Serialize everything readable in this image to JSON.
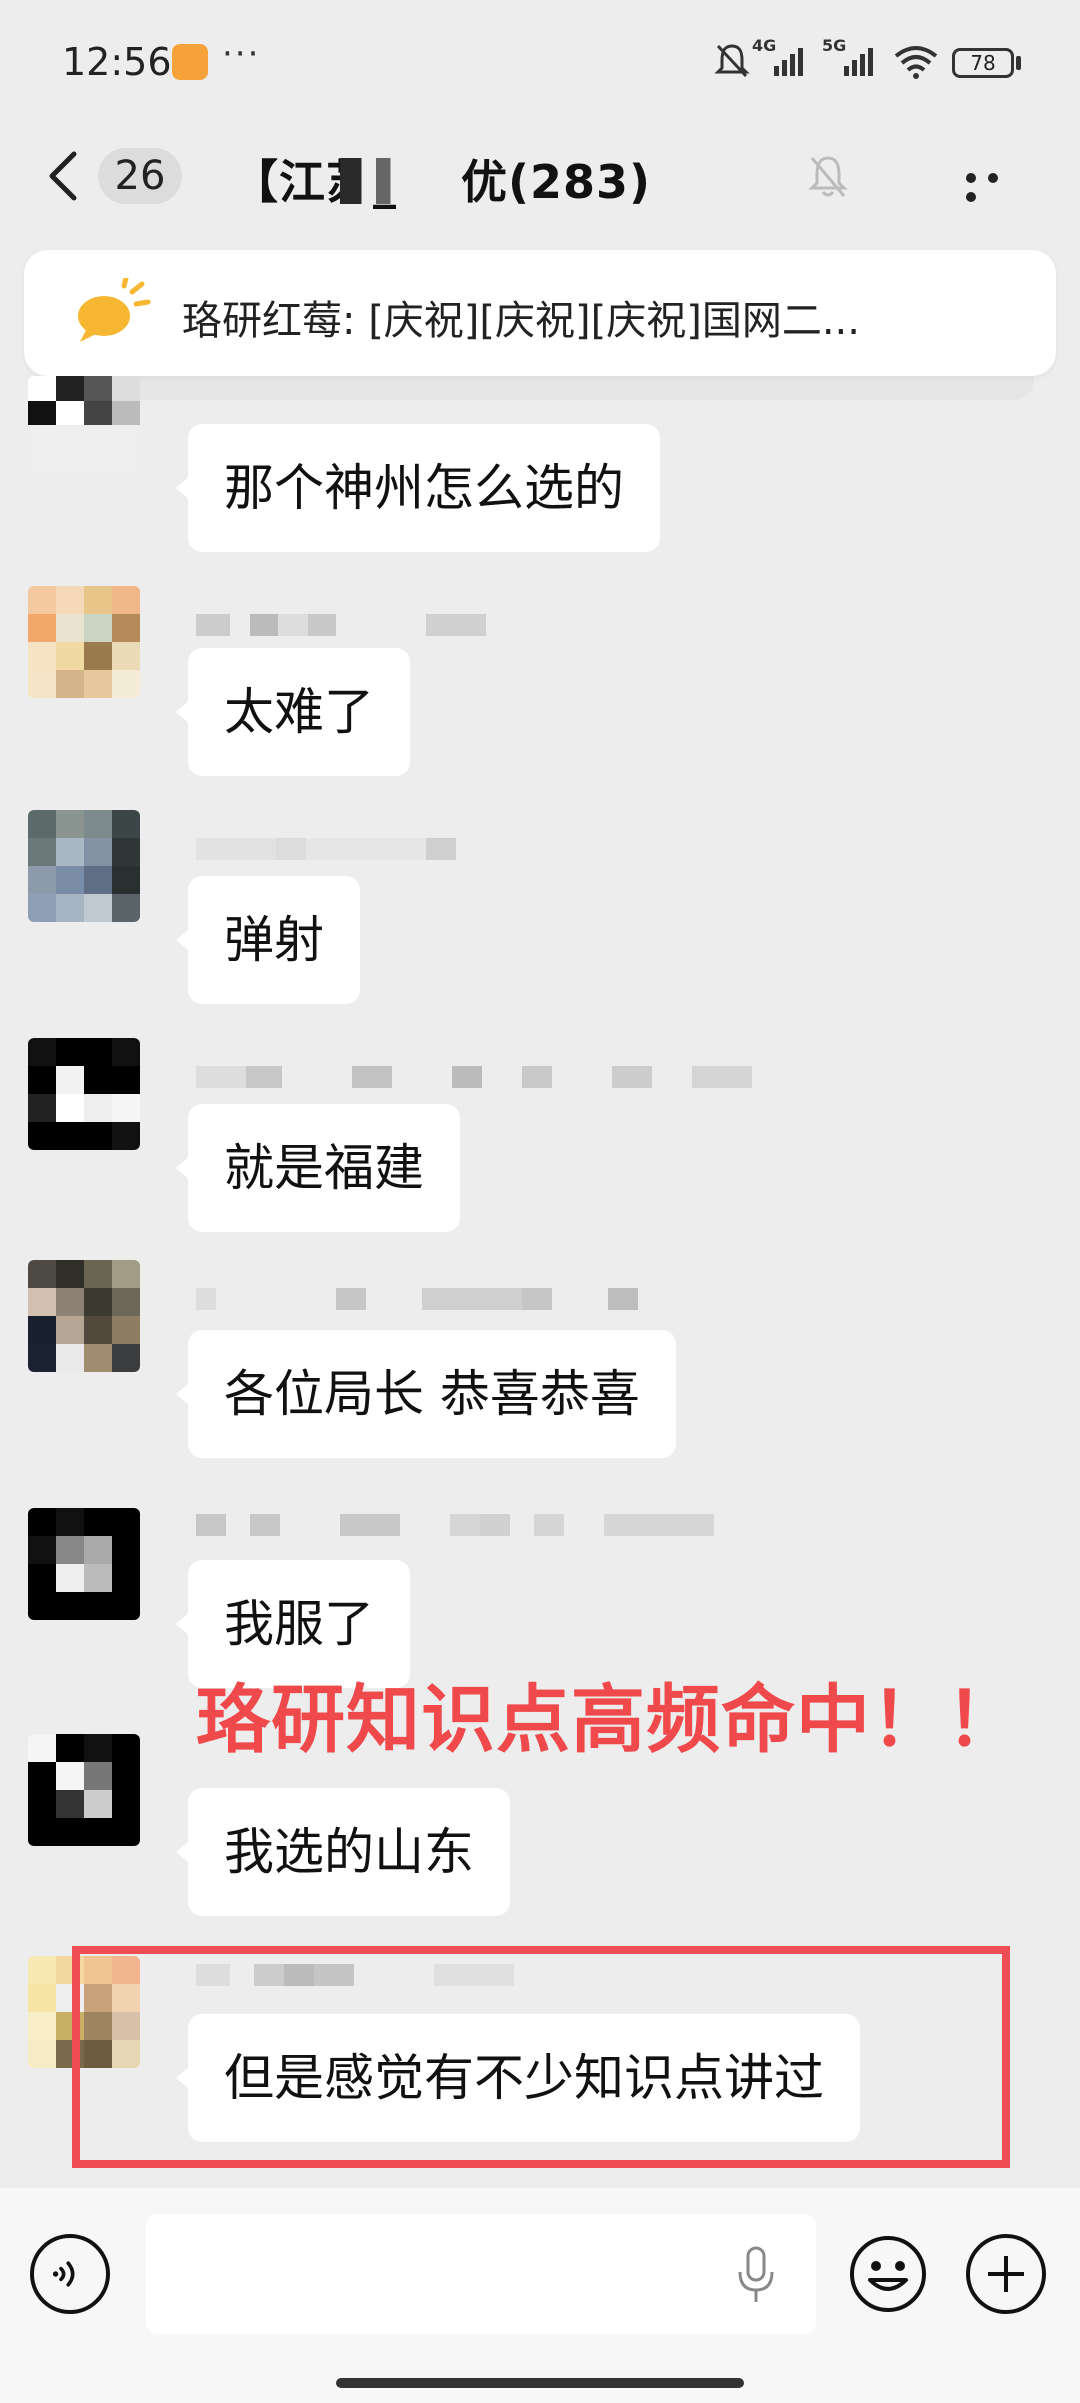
{
  "status_bar": {
    "time": "12:56",
    "more": "···",
    "network_1": "4G",
    "network_2": "5G",
    "battery": "78",
    "icons": [
      "app-notification-icon",
      "mute-bell-icon",
      "signal-icon",
      "wifi-icon",
      "battery-icon"
    ]
  },
  "header": {
    "unread_count": "26",
    "title": "【江苏_      培优(283)",
    "icons": [
      "back-chevron-icon",
      "mute-bell-icon",
      "more-dots-icon"
    ]
  },
  "pinned": {
    "text": "珞研红莓: [庆祝][庆祝][庆祝]国网二..."
  },
  "messages": [
    {
      "text": "那个神州怎么选的"
    },
    {
      "text": "太难了"
    },
    {
      "text": "弹射"
    },
    {
      "text": "就是福建"
    },
    {
      "text": "各位局长  恭喜恭喜"
    },
    {
      "text": "我服了"
    },
    {
      "text": "我选的山东"
    },
    {
      "text": "但是感觉有不少知识点讲过"
    }
  ],
  "overlay_caption": "珞研知识点高频命中！！",
  "colors": {
    "background": "#ededed",
    "bubble": "#ffffff",
    "highlight": "#ef4e55",
    "caption": "#f0494b"
  },
  "input": {
    "placeholder": "",
    "icons": [
      "voice-icon",
      "mic-icon",
      "emoji-icon",
      "plus-icon"
    ]
  }
}
